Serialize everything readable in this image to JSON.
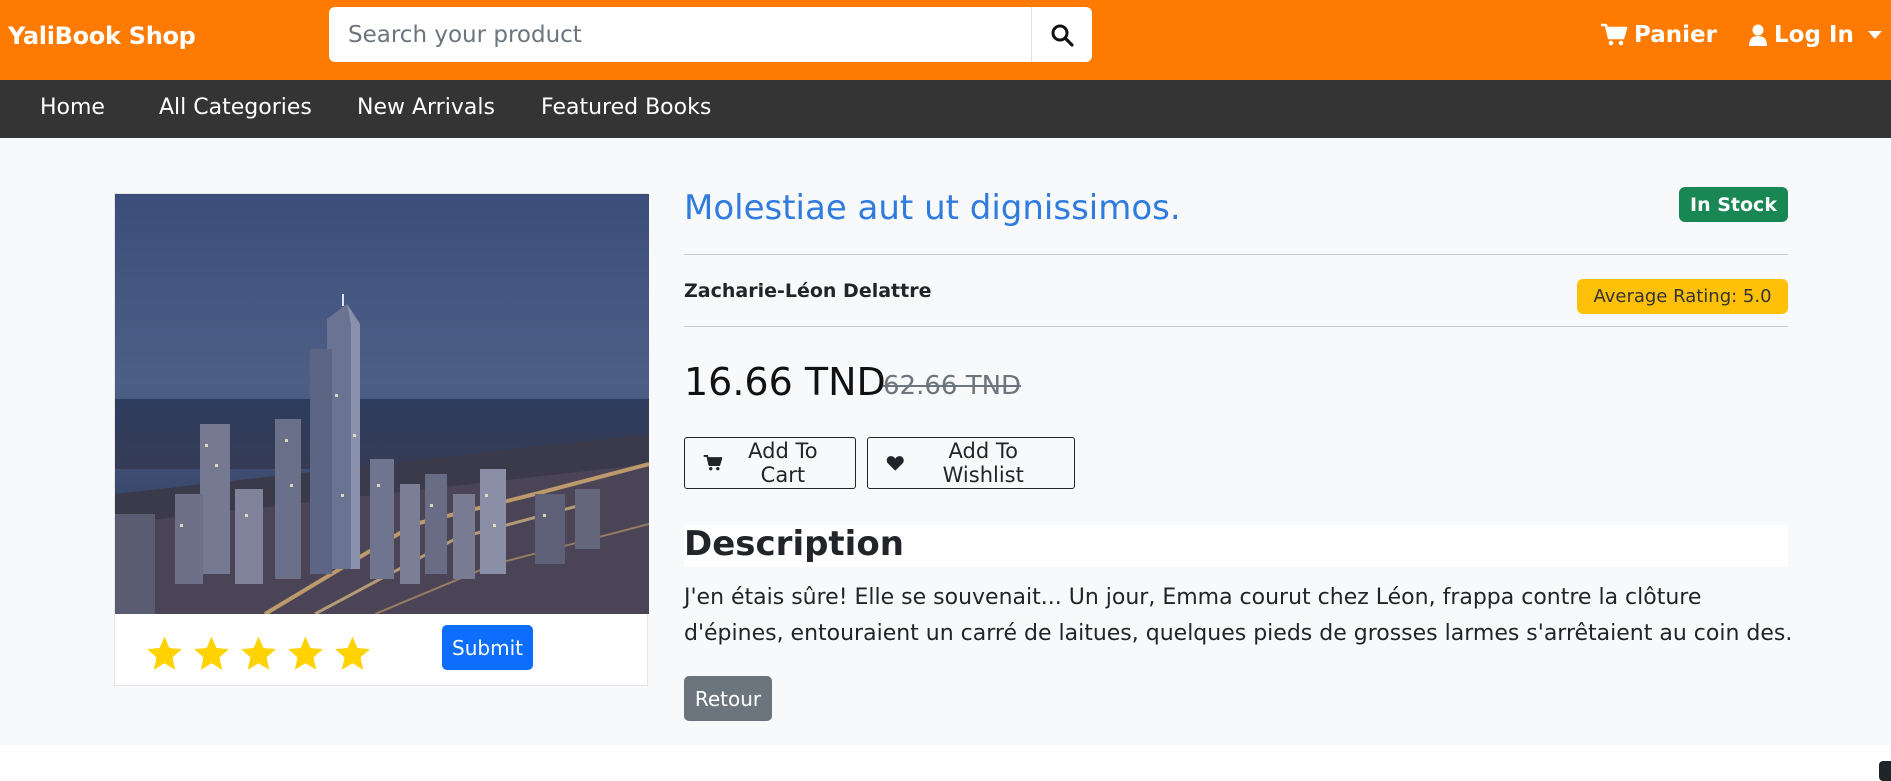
{
  "header": {
    "brand": "YaliBook Shop",
    "search_placeholder": "Search your product",
    "search_value": "",
    "cart_label": "Panier",
    "login_label": "Log In",
    "bar_color": "#ff7a00"
  },
  "nav": {
    "items": [
      {
        "label": "Home"
      },
      {
        "label": "All Categories"
      },
      {
        "label": "New Arrivals"
      },
      {
        "label": "Featured Books"
      }
    ]
  },
  "product": {
    "title": "Molestiae aut ut dignissimos.",
    "stock": "In Stock",
    "author": "Zacharie-Léon Delattre",
    "rating_badge": "Average Rating: 5.0",
    "price": "16.66 TND",
    "old_price": "62.66 TND",
    "add_to_cart": "Add To Cart",
    "add_to_wishlist": "Add To Wishlist",
    "description_heading": "Description",
    "description": "J'en étais sûre! Elle se souvenait... Un jour, Emma courut chez Léon, frappa contre la clôture d'épines, entouraient un carré de laitues, quelques pieds de grosses larmes s'arrêtaient au coin des.",
    "back_label": "Retour"
  },
  "rating_widget": {
    "stars_selected": 5,
    "stars_total": 5,
    "submit_label": "Submit",
    "star_color": "#ffd200"
  },
  "colors": {
    "title": "#2f7bde",
    "in_stock": "#198754",
    "rating_badge": "#ffc107",
    "submit": "#0d6efd",
    "back": "#6c757d",
    "navbar": "#343434"
  }
}
